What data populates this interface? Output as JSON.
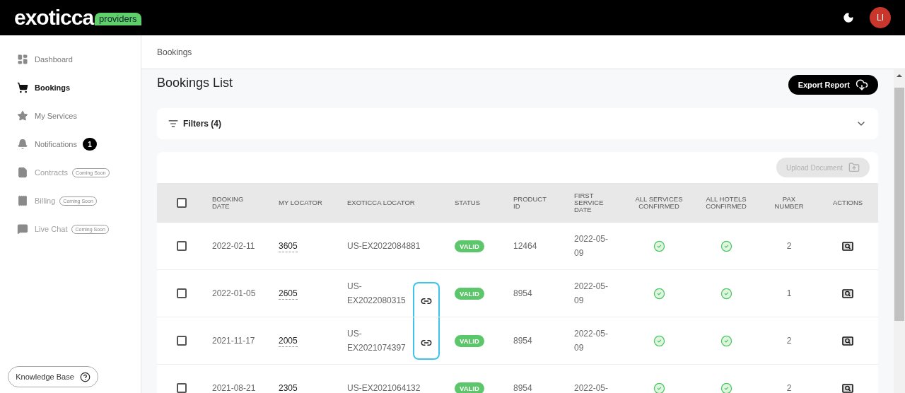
{
  "header": {
    "logo": "exoticca",
    "logo_tag": "providers",
    "avatar": "LI"
  },
  "sidebar": {
    "items": [
      {
        "label": "Dashboard",
        "selected": false,
        "disabled": false
      },
      {
        "label": "Bookings",
        "selected": true,
        "disabled": false
      },
      {
        "label": "My Services",
        "selected": false,
        "disabled": false
      },
      {
        "label": "Notifications",
        "selected": false,
        "disabled": false,
        "count": "1"
      },
      {
        "label": "Contracts",
        "selected": false,
        "disabled": true,
        "tag": "Coming Soon"
      },
      {
        "label": "Billing",
        "selected": false,
        "disabled": true,
        "tag": "Coming Soon"
      },
      {
        "label": "Live Chat",
        "selected": false,
        "disabled": true,
        "tag": "Coming Soon"
      }
    ],
    "help_button": "Knowledge Base"
  },
  "breadcrumb": "Bookings",
  "page_title": "Bookings List",
  "export_button": "Export Report",
  "filters": {
    "label": "Filters (4)",
    "expanded": false
  },
  "upload_button": {
    "label": "Upload Document",
    "disabled": true
  },
  "table": {
    "select_all_checked": false,
    "columns": [
      "BOOKING DATE",
      "MY LOCATOR",
      "EXOTICCA LOCATOR",
      "STATUS",
      "PRODUCT ID",
      "FIRST SERVICE DATE",
      "ALL SERVICES CONFIRMED",
      "ALL HOTELS CONFIRMED",
      "PAX NUMBER",
      "ACTIONS"
    ],
    "rows": [
      {
        "checked": false,
        "booking_date": "2022-02-11",
        "my_locator": "3605",
        "exoticca_locator": "US-EX2022084881",
        "linked": false,
        "status": "VALID",
        "product_id": "12464",
        "first_service_date": "2022-05-09",
        "services_confirmed": true,
        "hotels_confirmed": true,
        "pax": "2"
      },
      {
        "checked": false,
        "booking_date": "2022-01-05",
        "my_locator": "2605",
        "exoticca_locator": "US-EX2022080315",
        "linked": true,
        "status": "VALID",
        "product_id": "8954",
        "first_service_date": "2022-05-09",
        "services_confirmed": true,
        "hotels_confirmed": true,
        "pax": "1"
      },
      {
        "checked": false,
        "booking_date": "2021-11-17",
        "my_locator": "2005",
        "exoticca_locator": "US-EX2021074397",
        "linked": true,
        "status": "VALID",
        "product_id": "8954",
        "first_service_date": "2022-05-09",
        "services_confirmed": true,
        "hotels_confirmed": true,
        "pax": "2"
      },
      {
        "checked": false,
        "booking_date": "2021-08-21",
        "my_locator": "2305",
        "exoticca_locator": "US-EX2021064132",
        "linked": false,
        "status": "VALID",
        "product_id": "8954",
        "first_service_date": "2022-05-",
        "services_confirmed": true,
        "hotels_confirmed": true,
        "pax": "2"
      }
    ]
  }
}
